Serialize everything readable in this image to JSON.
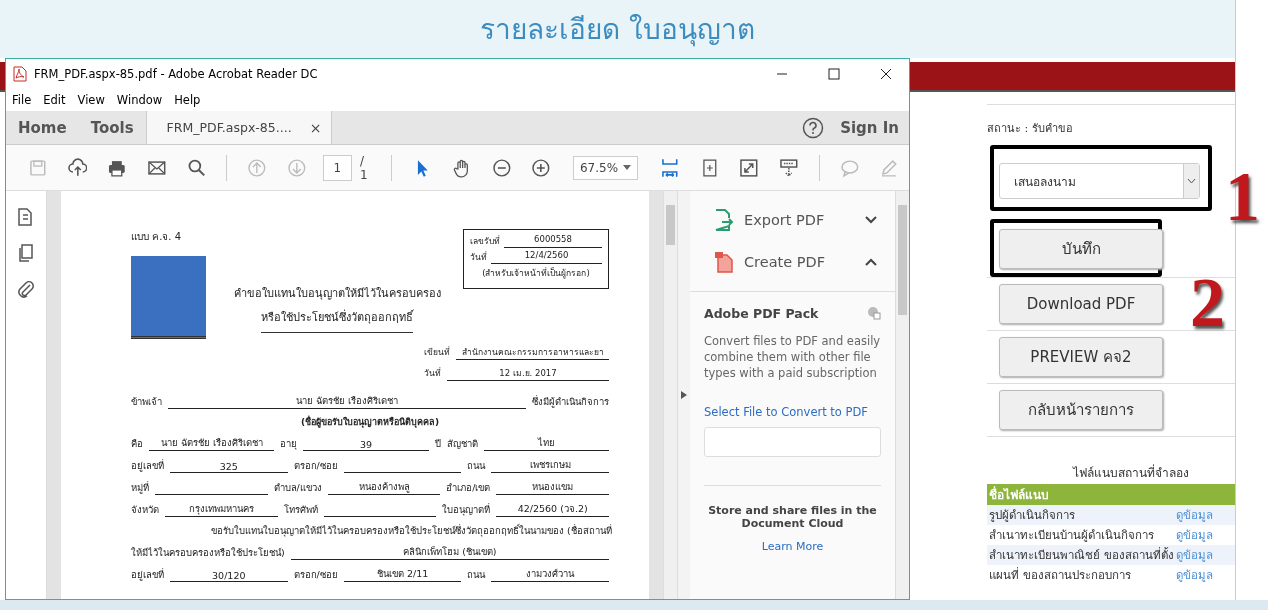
{
  "page": {
    "title": "รายละเอียด ใบอนุญาต"
  },
  "acrobat": {
    "title": "FRM_PDF.aspx-85.pdf - Adobe Acrobat Reader DC",
    "menu": [
      "File",
      "Edit",
      "View",
      "Window",
      "Help"
    ],
    "tabs": [
      {
        "label": "Home",
        "selected": false
      },
      {
        "label": "Tools",
        "selected": false
      },
      {
        "label": "FRM_PDF.aspx-85....",
        "close": "×",
        "selected": true
      }
    ],
    "sign_in": "Sign In",
    "toolbar": [
      {
        "kind": "save",
        "disabled": true
      },
      {
        "kind": "upload",
        "disabled": false
      },
      {
        "kind": "print",
        "disabled": false
      },
      {
        "kind": "mail",
        "disabled": false
      },
      {
        "kind": "search",
        "disabled": false
      },
      {
        "kind": "sep"
      },
      {
        "kind": "prev",
        "disabled": true
      },
      {
        "kind": "next",
        "disabled": true
      },
      {
        "kind": "page"
      },
      {
        "kind": "sep"
      },
      {
        "kind": "pointer",
        "disabled": false
      },
      {
        "kind": "hand",
        "disabled": false
      },
      {
        "kind": "zoomout",
        "disabled": false
      },
      {
        "kind": "zoomin",
        "disabled": false
      },
      {
        "kind": "zoom"
      },
      {
        "kind": "fit",
        "disabled": false
      },
      {
        "kind": "rotate",
        "disabled": false
      },
      {
        "kind": "fullscreen",
        "disabled": false
      },
      {
        "kind": "read",
        "disabled": false
      },
      {
        "kind": "sep"
      },
      {
        "kind": "comment",
        "disabled": true
      },
      {
        "kind": "pen",
        "disabled": true
      }
    ],
    "page_number": "1",
    "page_total": "/ 1",
    "zoom": "67.5%",
    "document": {
      "form_code": "แบบ ค.จ. 4",
      "receipt": [
        {
          "label": "เลขรับที่",
          "value": "6000558"
        },
        {
          "label": "วันที่",
          "value": "12/4/2560"
        }
      ],
      "receipt_note": "(สำหรับเจ้าหน้าที่เป็นผู้กรอก)",
      "title": [
        "คำขอใบแทนใบอนุญาตให้มีไว้ในครอบครอง",
        "หรือใช้ประโยชน์ซึ่งวัตถุออกฤทธิ์"
      ],
      "written_at": [
        {
          "label": "เขียนที่",
          "value": "สำนักงานคณะกรรมการอาหารและยา"
        },
        {
          "label": "วันที่",
          "value": "12 เม.ย. 2017"
        }
      ],
      "lines": [
        [
          {
            "kind": "label",
            "text": "ข้าพเจ้า"
          },
          {
            "kind": "value",
            "text": "นาย ฉัตรชัย เรืองศิริเดชา"
          },
          {
            "kind": "label",
            "text": "ซึ่งมีผู้ดำเนินกิจการ"
          }
        ],
        [
          {
            "kind": "note",
            "text": "(ชื่อผู้ขอรับใบอนุญาตหรือนิติบุคคล)"
          }
        ],
        [
          {
            "kind": "label",
            "text": "คือ"
          },
          {
            "kind": "value",
            "text": "นาย ฉัตรชัย เรืองศิริเดชา"
          },
          {
            "kind": "label",
            "text": "อายุ"
          },
          {
            "kind": "value",
            "text": "39"
          },
          {
            "kind": "label",
            "text": "ปี"
          },
          {
            "kind": "label",
            "text": "สัญชาติ"
          },
          {
            "kind": "value",
            "text": "ไทย"
          }
        ],
        [
          {
            "kind": "label",
            "text": "อยู่เลขที่"
          },
          {
            "kind": "value",
            "text": "325"
          },
          {
            "kind": "label",
            "text": "ตรอก/ซอย"
          },
          {
            "kind": "blank"
          },
          {
            "kind": "label",
            "text": "ถนน"
          },
          {
            "kind": "value",
            "text": "เพชรเกษม"
          }
        ],
        [
          {
            "kind": "label",
            "text": "หมู่ที่"
          },
          {
            "kind": "blank"
          },
          {
            "kind": "label",
            "text": "ตำบล/แขวง"
          },
          {
            "kind": "value",
            "text": "หนองค้างพลู"
          },
          {
            "kind": "label",
            "text": "อำเภอ/เขต"
          },
          {
            "kind": "value",
            "text": "หนองแขม"
          }
        ],
        [
          {
            "kind": "label",
            "text": "จังหวัด"
          },
          {
            "kind": "value",
            "text": "กรุงเทพมหานคร"
          },
          {
            "kind": "label",
            "text": "โทรศัพท์"
          },
          {
            "kind": "blank"
          },
          {
            "kind": "label",
            "text": "ใบอนุญาตที่"
          },
          {
            "kind": "value",
            "text": "42/2560 (วจ.2)"
          }
        ],
        [
          {
            "kind": "text",
            "text": "ขอรับใบแทนใบอนุญาตให้มีไว้ในครอบครองหรือใช้ประโยชน์ซึ่งวัตถุออกฤทธิ์ในนามของ (ชื่อสถานที่"
          }
        ],
        [
          {
            "kind": "label",
            "text": "ให้มีไว้ในครอบครองหรือใช้ประโยชน์)"
          },
          {
            "kind": "value",
            "text": "คลินิกเพ็ทโฮม (ชินเขต)"
          }
        ],
        [
          {
            "kind": "label",
            "text": "อยู่เลขที่"
          },
          {
            "kind": "value",
            "text": "30/120"
          },
          {
            "kind": "label",
            "text": "ตรอก/ซอย"
          },
          {
            "kind": "value",
            "text": "ชินเขต 2/11"
          },
          {
            "kind": "label",
            "text": "ถนน"
          },
          {
            "kind": "value",
            "text": "งามวงศ์วาน"
          }
        ]
      ]
    },
    "tools_pane": {
      "items": [
        {
          "kind": "export",
          "label": "Export PDF",
          "expanded": false
        },
        {
          "kind": "create",
          "label": "Create PDF",
          "expanded": true
        }
      ],
      "pack_title": "Adobe PDF Pack",
      "pack_text": "Convert files to PDF and easily combine them with other file types with a paid subscription",
      "select_link": "Select File to Convert to PDF",
      "cloud_text": "Store and share files in the Document Cloud",
      "learn_more": "Learn More"
    }
  },
  "sidebar": {
    "status": "สถานะ : รับคำขอ",
    "select_value": "เสนอลงนาม",
    "buttons": [
      "บันทึก",
      "Download PDF",
      "PREVIEW คจ2",
      "กลับหน้ารายการ"
    ],
    "callouts": [
      "1",
      "2"
    ],
    "attachments": {
      "title": "ไฟล์แนบสถานที่จำลอง",
      "header": "ชื่อไฟล์แนบ",
      "rows": [
        {
          "name": "รูปผู้ดำเนินกิจการ",
          "link": "ดูข้อมูล"
        },
        {
          "name": "สำเนาทะเบียนบ้านผู้ดำเนินกิจการ",
          "link": "ดูข้อมูล"
        },
        {
          "name": "สำเนาทะเบียนพาณิชย์ ของสถานที่ตั้ง",
          "link": "ดูข้อมูล"
        },
        {
          "name": "แผนที่ ของสถานประกอบการ",
          "link": "ดูข้อมูล"
        }
      ]
    }
  }
}
